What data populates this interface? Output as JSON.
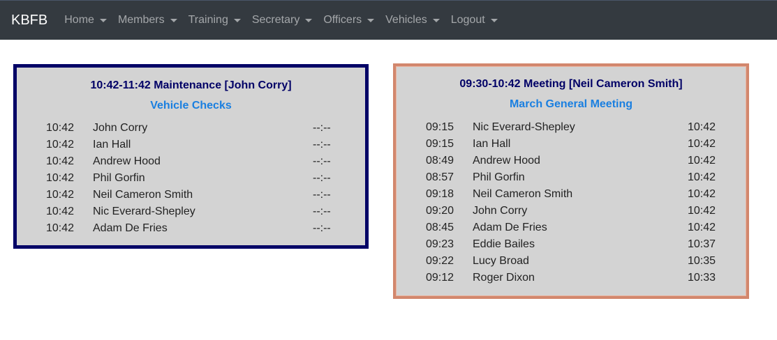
{
  "nav": {
    "brand": "KBFB",
    "items": [
      {
        "label": "Home"
      },
      {
        "label": "Members"
      },
      {
        "label": "Training"
      },
      {
        "label": "Secretary"
      },
      {
        "label": "Officers"
      },
      {
        "label": "Vehicles"
      },
      {
        "label": "Logout"
      }
    ]
  },
  "colors": {
    "navbar": "#343a40",
    "card_background": "#d3d3d3",
    "left_border": "#000066",
    "right_border": "#d2876d",
    "title": "#000066",
    "subtitle": "#1a7fe0"
  },
  "left_card": {
    "title": "10:42-11:42 Maintenance [John Corry]",
    "subtitle": "Vehicle Checks",
    "rows": [
      {
        "time_in": "10:42",
        "name": "John Corry",
        "time_out": "--:--"
      },
      {
        "time_in": "10:42",
        "name": "Ian Hall",
        "time_out": "--:--"
      },
      {
        "time_in": "10:42",
        "name": "Andrew Hood",
        "time_out": "--:--"
      },
      {
        "time_in": "10:42",
        "name": "Phil Gorfin",
        "time_out": "--:--"
      },
      {
        "time_in": "10:42",
        "name": "Neil Cameron Smith",
        "time_out": "--:--"
      },
      {
        "time_in": "10:42",
        "name": "Nic Everard-Shepley",
        "time_out": "--:--"
      },
      {
        "time_in": "10:42",
        "name": "Adam De Fries",
        "time_out": "--:--"
      }
    ]
  },
  "right_card": {
    "title": "09:30-10:42 Meeting [Neil Cameron Smith]",
    "subtitle": "March General Meeting",
    "rows": [
      {
        "time_in": "09:15",
        "name": "Nic Everard-Shepley",
        "time_out": "10:42"
      },
      {
        "time_in": "09:15",
        "name": "Ian Hall",
        "time_out": "10:42"
      },
      {
        "time_in": "08:49",
        "name": "Andrew Hood",
        "time_out": "10:42"
      },
      {
        "time_in": "08:57",
        "name": "Phil Gorfin",
        "time_out": "10:42"
      },
      {
        "time_in": "09:18",
        "name": "Neil Cameron Smith",
        "time_out": "10:42"
      },
      {
        "time_in": "09:20",
        "name": "John Corry",
        "time_out": "10:42"
      },
      {
        "time_in": "08:45",
        "name": "Adam De Fries",
        "time_out": "10:42"
      },
      {
        "time_in": "09:23",
        "name": "Eddie Bailes",
        "time_out": "10:37"
      },
      {
        "time_in": "09:22",
        "name": "Lucy Broad",
        "time_out": "10:35"
      },
      {
        "time_in": "09:12",
        "name": "Roger Dixon",
        "time_out": "10:33"
      }
    ]
  }
}
